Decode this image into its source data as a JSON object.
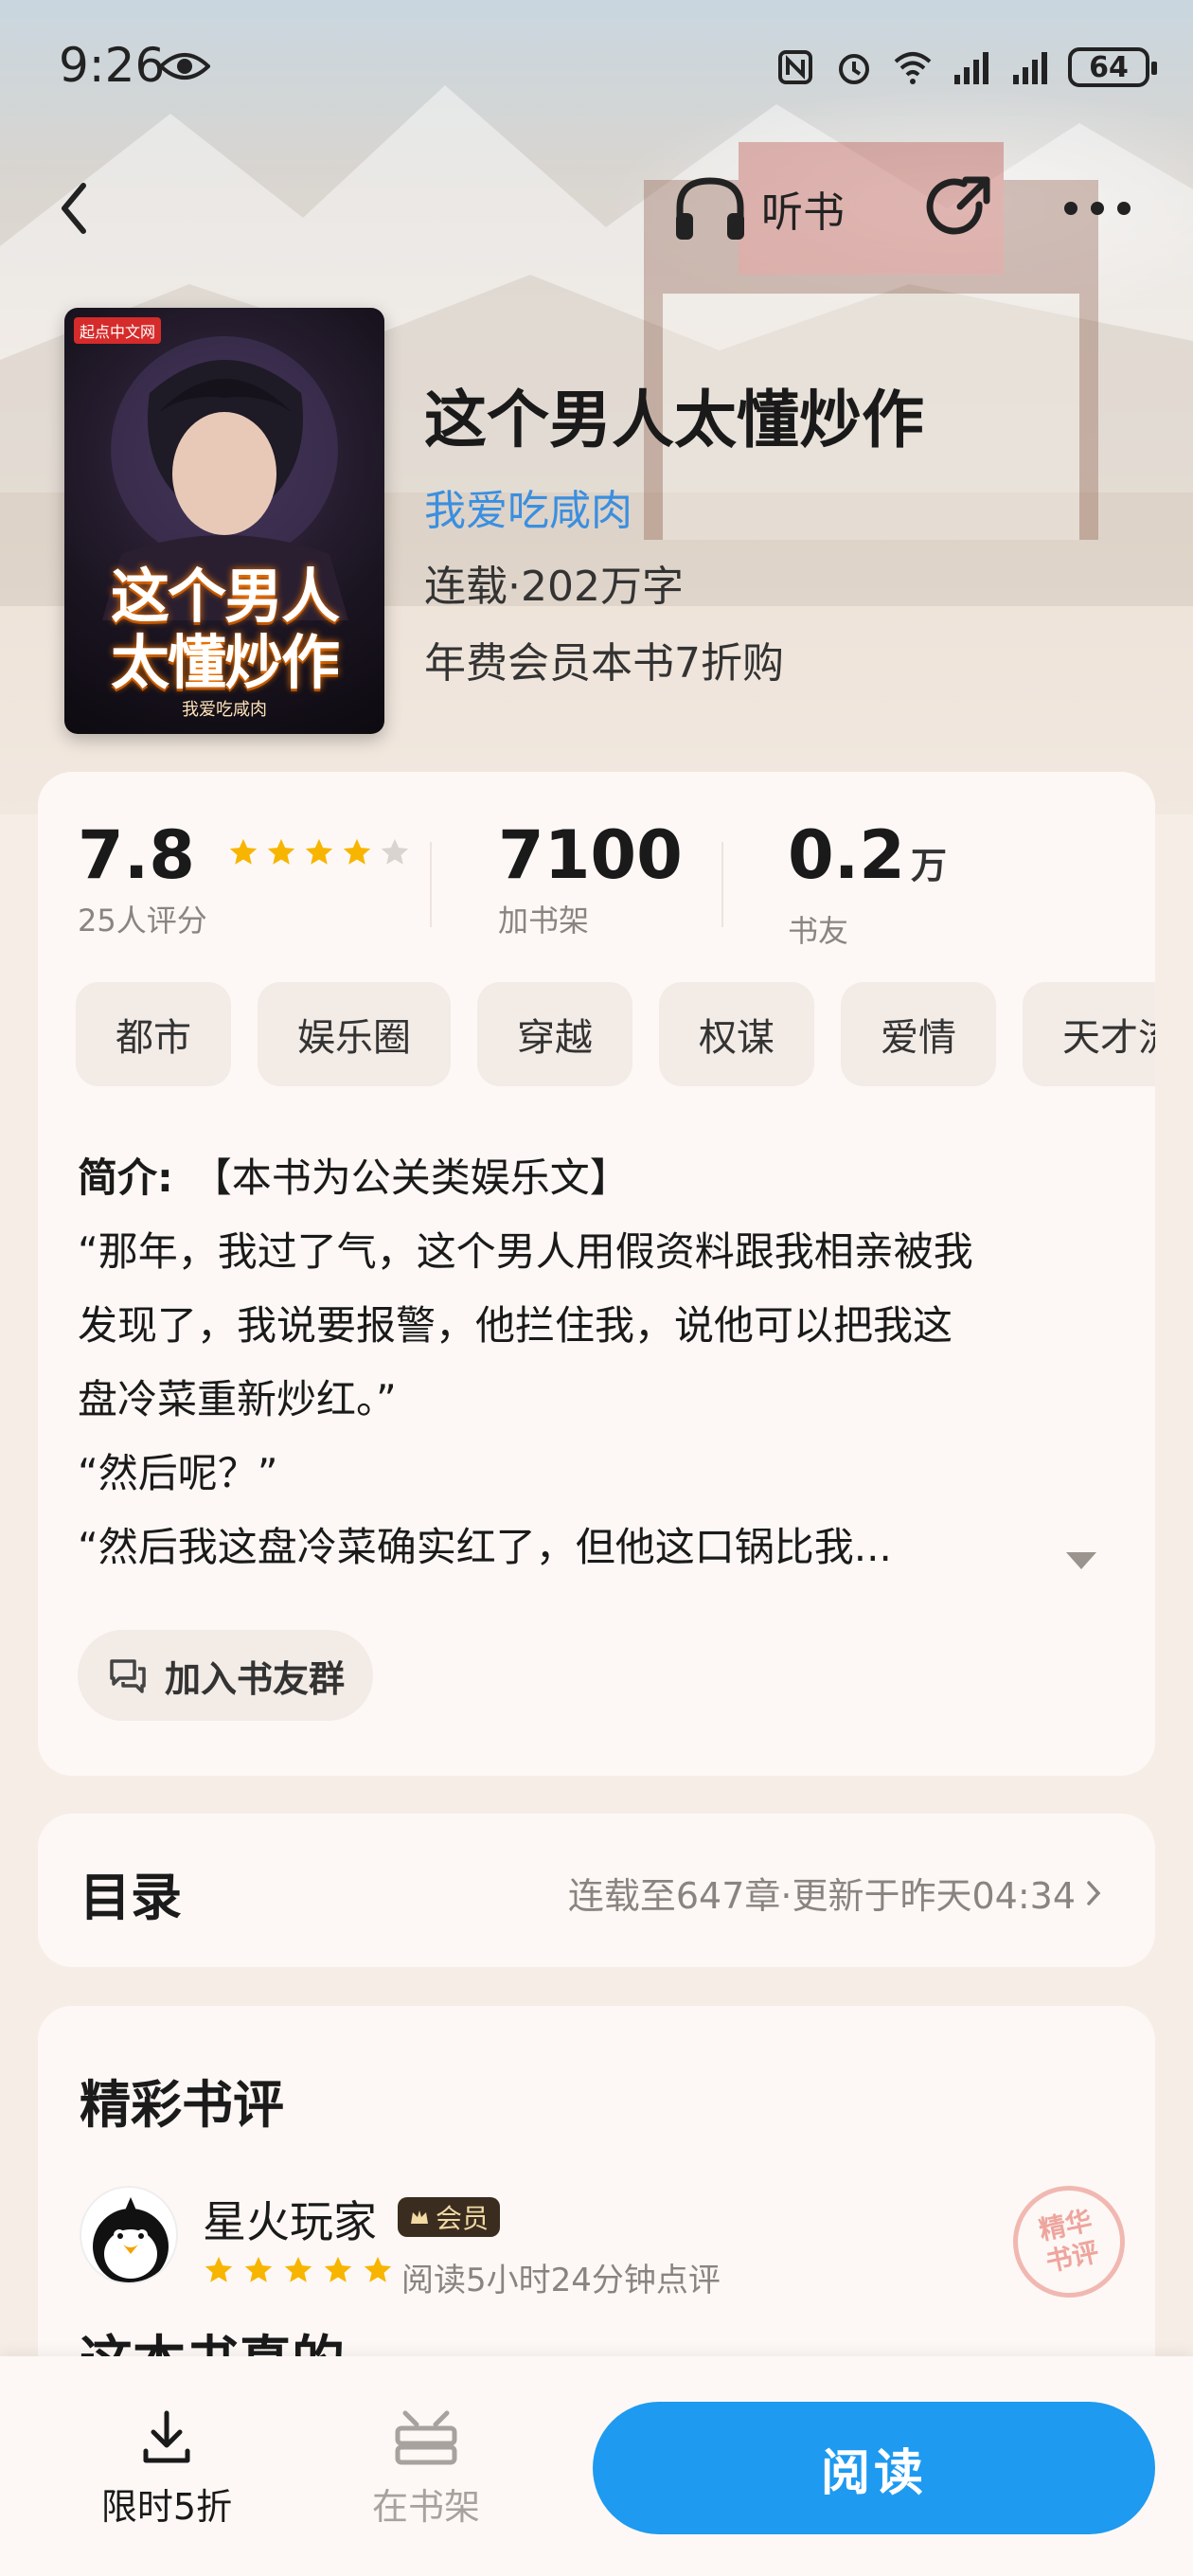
{
  "status_bar": {
    "time": "9:26",
    "battery": "64"
  },
  "nav": {
    "listen_label": "听书"
  },
  "book": {
    "cover_badge": "起点中文网",
    "cover_title_line1": "这个男人",
    "cover_title_line2": "太懂炒作",
    "cover_author": "我爱吃咸肉",
    "title": "这个男人太懂炒作",
    "author": "我爱吃咸肉",
    "status": "连载·202万字",
    "promo": "年费会员本书7折购"
  },
  "stats": {
    "rating": "7.8",
    "rating_stars": 4,
    "rating_count": "25人评分",
    "shelf_count": "7100",
    "shelf_label": "加书架",
    "fans_count": "0.2",
    "fans_unit": "万",
    "fans_label": "书友"
  },
  "tags": [
    "都市",
    "娱乐圈",
    "穿越",
    "权谋",
    "爱情",
    "天才流"
  ],
  "intro": {
    "label": "简介:",
    "line1": "【本书为公关类娱乐文】",
    "line2": "“那年，我过了气，这个男人用假资料跟我相亲被我",
    "line3": "发现了，我说要报警，他拦住我，说他可以把我这",
    "line4": "盘冷菜重新炒红。”",
    "line5": "“然后呢？”",
    "line6": "“然后我这盘冷菜确实红了，但他这口锅比我..."
  },
  "join_group_label": "加入书友群",
  "toc": {
    "title": "目录",
    "info": "连载至647章·更新于昨天04:34"
  },
  "reviews": {
    "title": "精彩书评",
    "reviewer": "星火玩家",
    "member_badge": "会员",
    "stars": 5,
    "meta": "阅读5小时24分钟点评",
    "seal_line1": "精华",
    "seal_line2": "书评",
    "snippet": "这本书真的"
  },
  "bottom_bar": {
    "sale_label": "限时5折",
    "shelf_label": "在书架",
    "read_label": "阅读"
  },
  "colors": {
    "accent_blue": "#1e9af0",
    "author_blue": "#3a8fe0",
    "star_gold": "#f7b500"
  }
}
